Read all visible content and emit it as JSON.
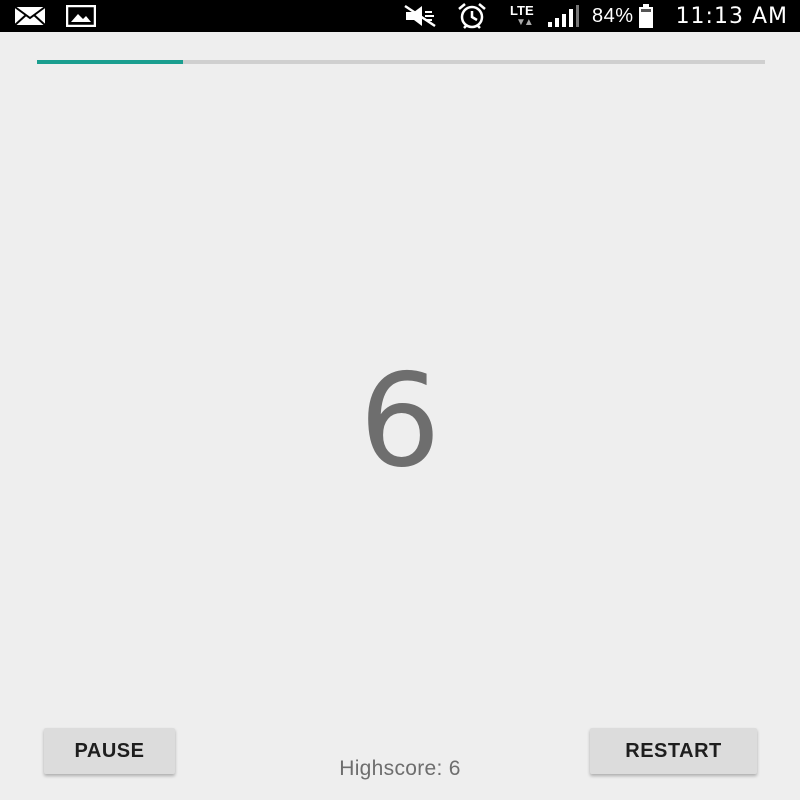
{
  "status_bar": {
    "icons_left": [
      "mail-icon",
      "image-icon"
    ],
    "icons_right": [
      "vibrate-mute-icon",
      "alarm-icon",
      "lte-icon",
      "signal-icon",
      "battery-icon"
    ],
    "network": "LTE",
    "battery_percent": "84%",
    "time": "11:13 AM"
  },
  "progress": {
    "fraction": 0.2,
    "color": "#1a9e8f",
    "track_color": "#cfcfcf"
  },
  "score": "6",
  "controls": {
    "pause_label": "PAUSE",
    "restart_label": "RESTART"
  },
  "highscore_text": "Highscore: 6"
}
